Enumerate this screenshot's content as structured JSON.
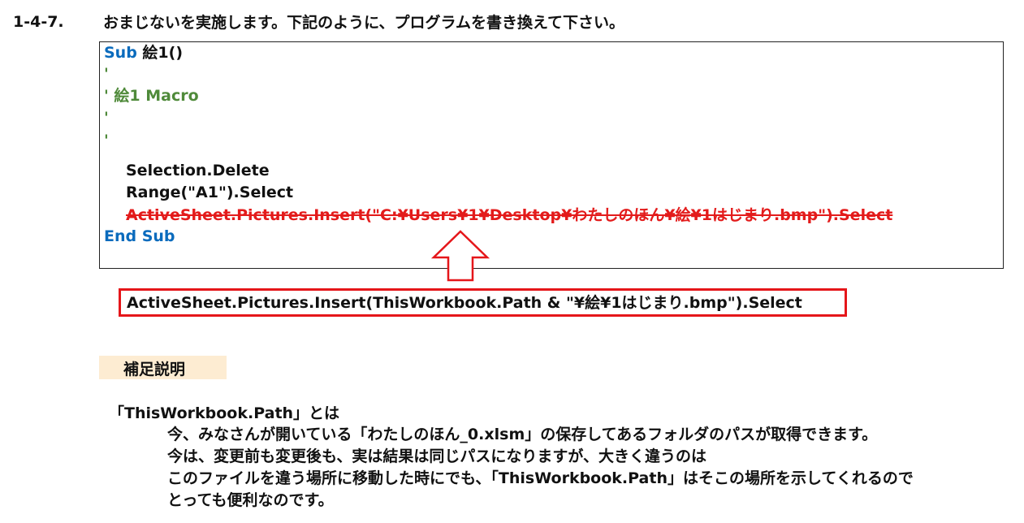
{
  "step": {
    "number": "1-4-7.",
    "title": "おまじないを実施します。下記のように、プログラムを書き換えて下さい。"
  },
  "code": {
    "sub_keyword": "Sub",
    "sub_name": " 絵1()",
    "comment_1": "'",
    "comment_2": "' 絵1 Macro",
    "comment_3": "'",
    "comment_4": "'",
    "line_delete": "Selection.Delete",
    "line_range": "Range(\"A1\").Select",
    "line_old_insert": "ActiveSheet.Pictures.Insert(\"C:¥Users¥1¥Desktop¥わたしのほん¥絵¥1はじまり.bmp\").Select",
    "end_sub": "End Sub"
  },
  "replacement": {
    "text": "ActiveSheet.Pictures.Insert(ThisWorkbook.Path & \"¥絵¥1はじまり.bmp\").Select"
  },
  "note": {
    "heading": "補足説明",
    "term": "「ThisWorkbook.Path」とは",
    "lines": [
      "今、みなさんが開いている「わたしのほん_0.xlsm」の保存してあるフォルダのパスが取得できます。",
      "今は、変更前も変更後も、実は結果は同じパスになりますが、大きく違うのは",
      "このファイルを違う場所に移動した時にでも、「ThisWorkbook.Path」はそこの場所を示してくれるので",
      "とっても便利なのです。"
    ]
  },
  "colors": {
    "keyword": "#0a6bbd",
    "comment": "#4f8a3a",
    "strike": "#e31b1b",
    "highlight_border": "#e5161a",
    "heading_bg": "#fdecd2"
  },
  "icons": {
    "arrow": "hollow-up-arrow-icon"
  }
}
